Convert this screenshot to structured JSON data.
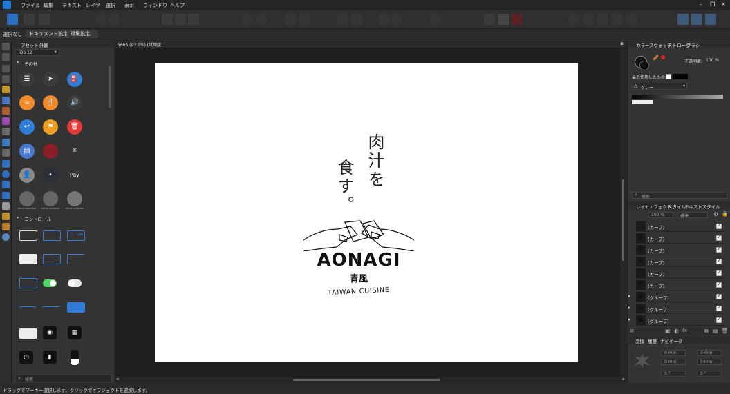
{
  "menu": {
    "items": [
      "ファイル",
      "編集",
      "テキスト",
      "レイヤ",
      "選択",
      "表示",
      "ウィンドウ",
      "ヘルプ"
    ]
  },
  "window_controls": {
    "minimize": "–",
    "restore": "❐",
    "close": "✕"
  },
  "context": {
    "selection": "選択なし",
    "document_setup": "ドキュメント設定...",
    "preferences": "環境設定..."
  },
  "left_panel": {
    "tabs": [
      "アセット",
      "外観"
    ],
    "preset": "iOS 12",
    "section_other": "その他",
    "section_controls": "コントロール",
    "search_placeholder": "検索",
    "assets": [
      {
        "icon": "list-icon",
        "color": "#3b3b3b",
        "glyph": "☰"
      },
      {
        "icon": "location-arrow-icon",
        "color": "#3b3b3b",
        "glyph": "➤"
      },
      {
        "icon": "fuel-icon",
        "color": "#2e7dd7",
        "glyph": "⛽"
      },
      {
        "icon": "cup-icon",
        "color": "#f08a2a",
        "glyph": "☕"
      },
      {
        "icon": "cutlery-icon",
        "color": "#f08a2a",
        "glyph": "🍴"
      },
      {
        "icon": "speaker-icon",
        "color": "#3b3b3b",
        "glyph": "🔊"
      },
      {
        "icon": "reply-icon",
        "color": "#2e7dd7",
        "glyph": "↩"
      },
      {
        "icon": "flag-icon",
        "color": "#f0a020",
        "glyph": "⚑"
      },
      {
        "icon": "trash-icon",
        "color": "#e53935",
        "glyph": "🗑"
      },
      {
        "icon": "archive-icon",
        "color": "#4a7ad0",
        "glyph": "▤"
      },
      {
        "icon": "pattern-icon",
        "color": "#8a1f28",
        "glyph": ""
      },
      {
        "icon": "spinner-icon",
        "color": "#333333",
        "glyph": "✳"
      },
      {
        "icon": "avatar-icon",
        "color": "#8a8a8a",
        "glyph": "👤"
      },
      {
        "icon": "dot-icon",
        "color": "#2a2f3a",
        "glyph": "•"
      },
      {
        "icon": "apple-pay-icon",
        "color": "#333333",
        "glyph": "Pay"
      },
      {
        "icon": "home-icon",
        "color": "#666666",
        "glyph": ""
      },
      {
        "icon": "home-icon",
        "color": "#666666",
        "glyph": ""
      },
      {
        "icon": "badge-icon",
        "color": "#777777",
        "glyph": ""
      }
    ],
    "asset_small_labels": [
      "Home Indicator",
      "Home Indicator",
      "Home Indicator"
    ],
    "ctrl_label": "Lab"
  },
  "document": {
    "tab_title": "5665 (93.1%) [試用版]"
  },
  "artwork": {
    "vertical_text_col1": "肉汁を",
    "vertical_text_col2": "食す。",
    "brand": "AONAGI",
    "brand_kanji": "青風",
    "tagline": "TAIWAN CUISINE"
  },
  "right_panel": {
    "tabs_top": [
      "カラー",
      "スウォッチ",
      "ストローク",
      "ブラシ"
    ],
    "opacity_label": "不透明度:",
    "opacity_value": "100 %",
    "recent_label": "最近使用したもの:",
    "palette_name": "グレー",
    "search_placeholder": "検索",
    "tabs_layers": [
      "レイヤ",
      "エフェクト",
      "スタイル",
      "テキストスタイル"
    ],
    "layer_opacity": "100 %",
    "blend_mode": "標準",
    "layers": [
      {
        "name": "(カーブ)",
        "glyph": "○"
      },
      {
        "name": "(カーブ)",
        "glyph": "す"
      },
      {
        "name": "(カーブ)",
        "glyph": "食"
      },
      {
        "name": "(カーブ)",
        "glyph": "を"
      },
      {
        "name": "(カーブ)",
        "glyph": "汁"
      },
      {
        "name": "(カーブ)",
        "glyph": "肉"
      },
      {
        "name": "(グループ)",
        "glyph": "▪"
      },
      {
        "name": "(グループ)",
        "glyph": "▪"
      },
      {
        "name": "(グループ)",
        "glyph": "▪"
      }
    ],
    "tabs_transform": [
      "変換",
      "履歴",
      "ナビゲータ"
    ],
    "transform_fields": [
      "0 mm",
      "0 mm",
      "0 mm",
      "0 mm",
      "0 °",
      "0 °"
    ]
  },
  "status": {
    "text": "ドラッグでマーキー選択します。クリックでオブジェクトを選択します。"
  }
}
